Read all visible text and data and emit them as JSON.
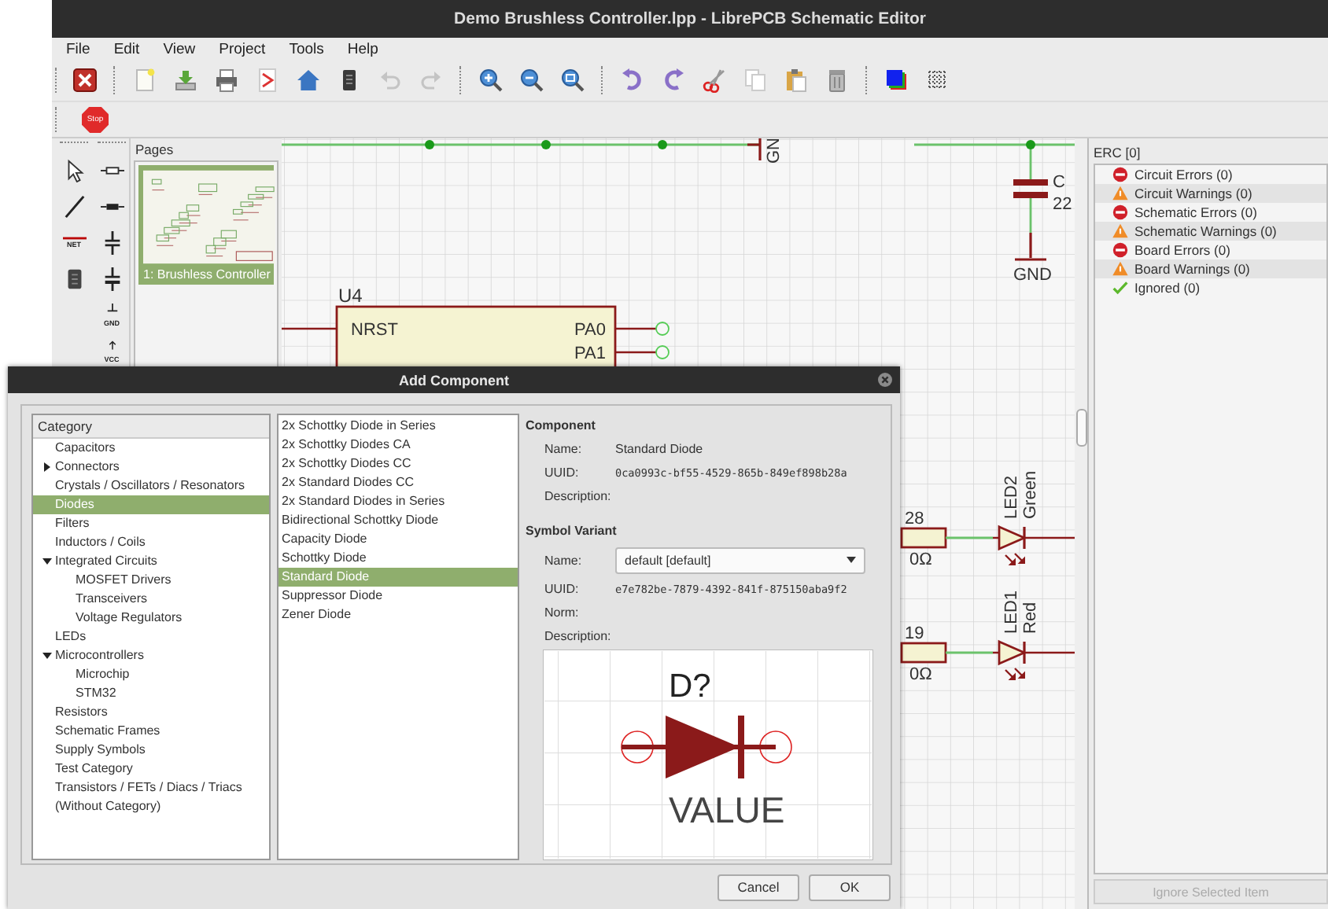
{
  "window": {
    "title": "Demo Brushless Controller.lpp - LibrePCB Schematic Editor"
  },
  "menu": [
    "File",
    "Edit",
    "View",
    "Project",
    "Tools",
    "Help"
  ],
  "toolbar": [
    {
      "kind": "close",
      "disabled": false
    },
    {
      "kind": "separator"
    },
    {
      "kind": "new",
      "disabled": false
    },
    {
      "kind": "save",
      "disabled": false
    },
    {
      "kind": "print",
      "disabled": false
    },
    {
      "kind": "pdf",
      "disabled": false
    },
    {
      "kind": "home",
      "disabled": false
    },
    {
      "kind": "board",
      "disabled": false
    },
    {
      "kind": "undo",
      "disabled": true
    },
    {
      "kind": "redo",
      "disabled": true
    },
    {
      "kind": "separator"
    },
    {
      "kind": "zoom-in",
      "disabled": false
    },
    {
      "kind": "zoom-out",
      "disabled": false
    },
    {
      "kind": "zoom-fit",
      "disabled": false
    },
    {
      "kind": "separator"
    },
    {
      "kind": "rotate-ccw",
      "disabled": false
    },
    {
      "kind": "rotate-cw",
      "disabled": false
    },
    {
      "kind": "cut",
      "disabled": false
    },
    {
      "kind": "copy",
      "disabled": false
    },
    {
      "kind": "paste",
      "disabled": false
    },
    {
      "kind": "delete",
      "disabled": false
    },
    {
      "kind": "separator"
    },
    {
      "kind": "layers",
      "disabled": false
    },
    {
      "kind": "grid",
      "disabled": false
    }
  ],
  "stop_button": {
    "label": "Stop"
  },
  "tools": {
    "column_1": [
      {
        "kind": "select",
        "selected": false
      },
      {
        "kind": "wire",
        "selected": false
      },
      {
        "kind": "net-label",
        "label": "NET",
        "selected": false
      },
      {
        "kind": "component",
        "selected": false
      }
    ],
    "column_2": [
      {
        "kind": "resistor",
        "selected": false
      },
      {
        "kind": "resistor-filled",
        "selected": false
      },
      {
        "kind": "capacitor",
        "selected": false
      },
      {
        "kind": "polarized-capacitor",
        "selected": false
      },
      {
        "kind": "ground",
        "label": "GND",
        "selected": false
      },
      {
        "kind": "supply",
        "label": "VCC",
        "selected": false
      }
    ]
  },
  "pages": {
    "title": "Pages",
    "items": [
      {
        "label": "1: Brushless Controller",
        "selected": true
      }
    ]
  },
  "schematic": {
    "supply_label": "GN",
    "capacitor": {
      "name": "C",
      "value": "22",
      "ground": "GND"
    },
    "ic": {
      "name": "U4",
      "pins": [
        {
          "label": "NRST",
          "kind": "left"
        },
        {
          "label": "PA0",
          "kind": "right"
        },
        {
          "label": "PA1",
          "kind": "right"
        }
      ]
    },
    "leds": [
      {
        "resistor_name": "28",
        "resistor_value": "0Ω",
        "name": "LED2",
        "value": "Green"
      },
      {
        "resistor_name": "19",
        "resistor_value": "0Ω",
        "name": "LED1",
        "value": "Red"
      }
    ]
  },
  "erc": {
    "title": "ERC [0]",
    "items": [
      {
        "kind": "error",
        "label": "Circuit Errors (0)"
      },
      {
        "kind": "warning",
        "label": "Circuit Warnings (0)"
      },
      {
        "kind": "error",
        "label": "Schematic Errors (0)"
      },
      {
        "kind": "warning",
        "label": "Schematic Warnings (0)"
      },
      {
        "kind": "error",
        "label": "Board Errors (0)"
      },
      {
        "kind": "warning",
        "label": "Board Warnings (0)"
      },
      {
        "kind": "ok",
        "label": "Ignored (0)"
      }
    ],
    "button": {
      "label": "Ignore Selected Item",
      "disabled": true
    }
  },
  "dialog": {
    "title": "Add Component",
    "category_header": "Category",
    "categories": [
      {
        "label": "Capacitors",
        "selected": false
      },
      {
        "label": "Connectors",
        "selected": false,
        "expanded": false
      },
      {
        "label": "Crystals / Oscillators / Resonators",
        "selected": false
      },
      {
        "label": "Diodes",
        "selected": true
      },
      {
        "label": "Filters",
        "selected": false
      },
      {
        "label": "Inductors / Coils",
        "selected": false
      },
      {
        "label": "Integrated Circuits",
        "selected": false,
        "expanded": true,
        "children": [
          {
            "label": "MOSFET Drivers",
            "selected": false
          },
          {
            "label": "Transceivers",
            "selected": false
          },
          {
            "label": "Voltage Regulators",
            "selected": false
          }
        ]
      },
      {
        "label": "LEDs",
        "selected": false
      },
      {
        "label": "Microcontrollers",
        "selected": false,
        "expanded": true,
        "children": [
          {
            "label": "Microchip",
            "selected": false
          },
          {
            "label": "STM32",
            "selected": false
          }
        ]
      },
      {
        "label": "Resistors",
        "selected": false
      },
      {
        "label": "Schematic Frames",
        "selected": false
      },
      {
        "label": "Supply Symbols",
        "selected": false
      },
      {
        "label": "Test Category",
        "selected": false
      },
      {
        "label": "Transistors / FETs / Diacs / Triacs",
        "selected": false
      },
      {
        "label": "(Without Category)",
        "selected": false
      }
    ],
    "components": [
      {
        "label": "2x Schottky Diode in Series",
        "selected": false
      },
      {
        "label": "2x Schottky Diodes CA",
        "selected": false
      },
      {
        "label": "2x Schottky Diodes CC",
        "selected": false
      },
      {
        "label": "2x Standard Diodes CC",
        "selected": false
      },
      {
        "label": "2x Standard Diodes in Series",
        "selected": false
      },
      {
        "label": "Bidirectional Schottky Diode",
        "selected": false
      },
      {
        "label": "Capacity Diode",
        "selected": false
      },
      {
        "label": "Schottky Diode",
        "selected": false
      },
      {
        "label": "Standard Diode",
        "selected": true
      },
      {
        "label": "Suppressor Diode",
        "selected": false
      },
      {
        "label": "Zener Diode",
        "selected": false
      }
    ],
    "component": {
      "heading": "Component",
      "fields": [
        {
          "label": "Name:",
          "value": "Standard Diode",
          "kind": "text"
        },
        {
          "label": "UUID:",
          "value": "0ca0993c-bf55-4529-865b-849ef898b28a",
          "kind": "mono"
        },
        {
          "label": "Description:"
        }
      ]
    },
    "symbol_variant": {
      "heading": "Symbol Variant",
      "name_label": "Name:",
      "selection": "default [default]",
      "fields": [
        {
          "label": "UUID:",
          "value": "e7e782be-7879-4392-841f-875150aba9f2",
          "kind": "mono"
        },
        {
          "label": "Norm:"
        },
        {
          "label": "Description:"
        }
      ]
    },
    "preview": {
      "name": "D?",
      "value": "VALUE"
    },
    "buttons": [
      "Cancel",
      "OK"
    ]
  }
}
